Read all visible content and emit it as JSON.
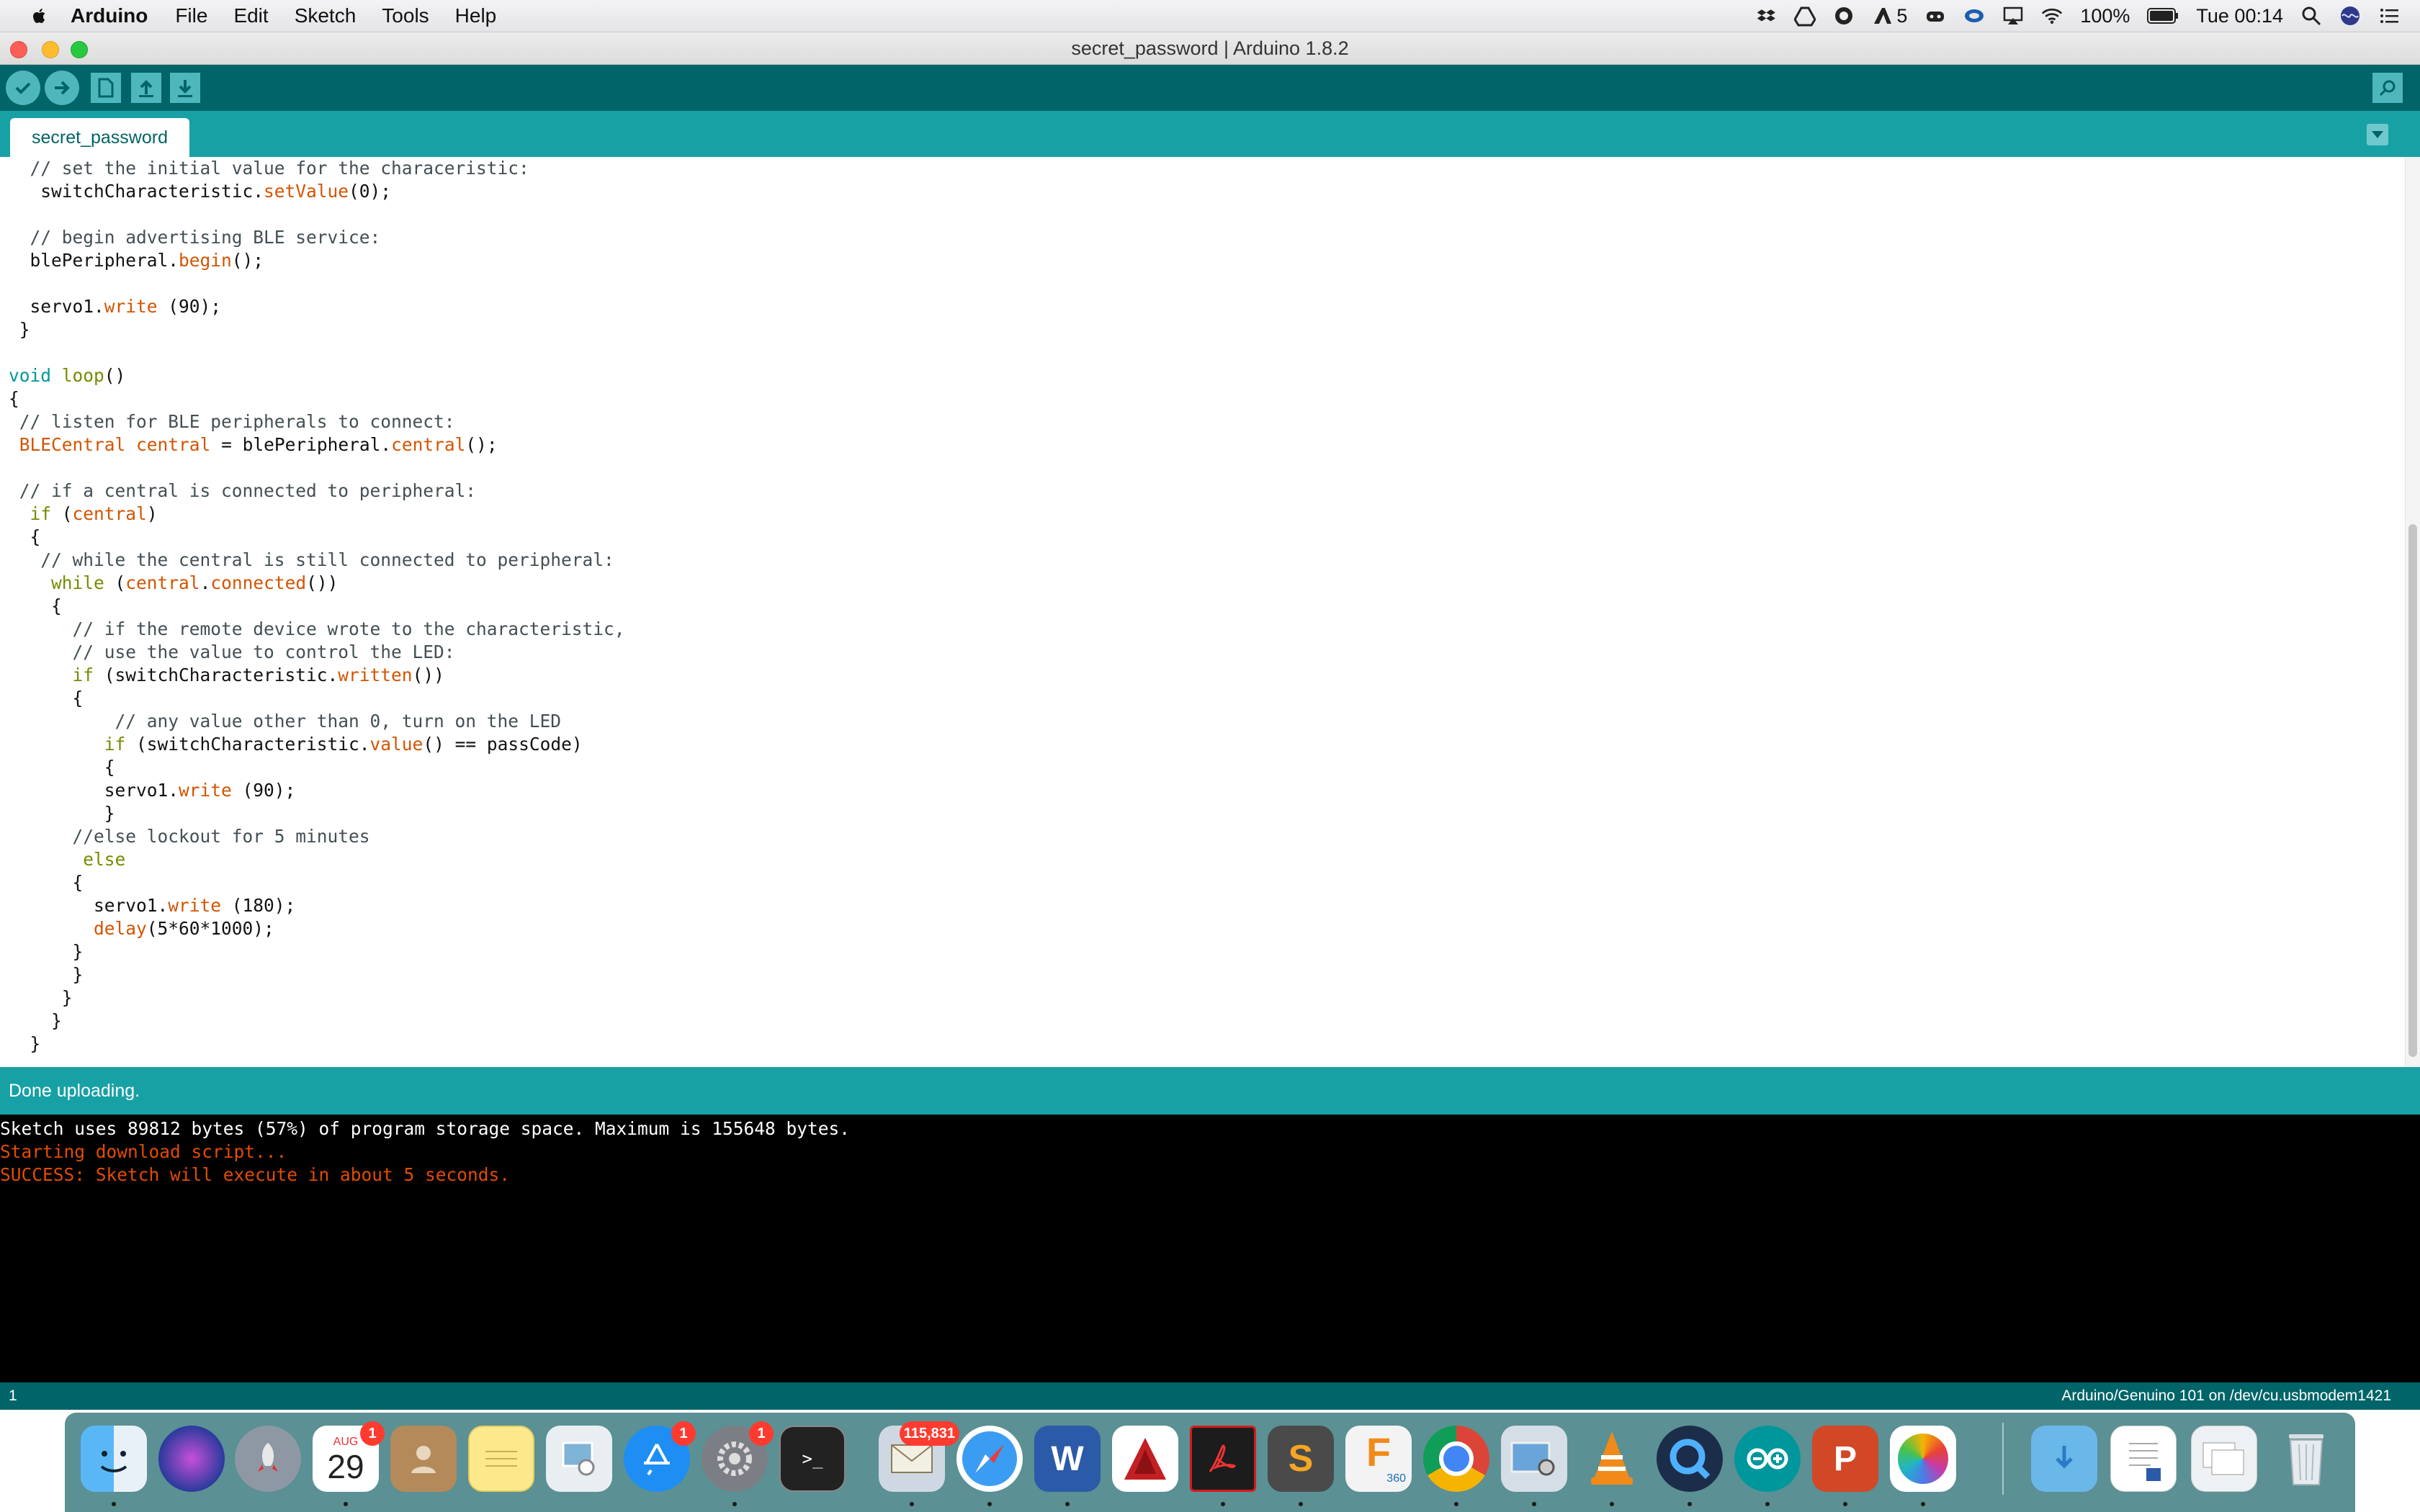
{
  "menubar": {
    "app_name": "Arduino",
    "menus": [
      "File",
      "Edit",
      "Sketch",
      "Tools",
      "Help"
    ],
    "adobe_count": "5",
    "battery": "100%",
    "clock": "Tue 00:14"
  },
  "window": {
    "title": "secret_password | Arduino 1.8.2"
  },
  "tabs": {
    "active": "secret_password"
  },
  "code_lines": [
    [
      {
        "t": "  // set the initial value for the characeristic:",
        "c": "cm"
      }
    ],
    [
      {
        "t": "   switchCharacteristic."
      },
      {
        "t": "setValue",
        "c": "fn"
      },
      {
        "t": "(0);"
      }
    ],
    [
      {
        "t": ""
      }
    ],
    [
      {
        "t": "  // begin advertising BLE service:",
        "c": "cm"
      }
    ],
    [
      {
        "t": "  blePeripheral."
      },
      {
        "t": "begin",
        "c": "fn"
      },
      {
        "t": "();"
      }
    ],
    [
      {
        "t": ""
      }
    ],
    [
      {
        "t": "  servo1."
      },
      {
        "t": "write",
        "c": "fn"
      },
      {
        "t": " (90);"
      }
    ],
    [
      {
        "t": " }"
      }
    ],
    [
      {
        "t": ""
      }
    ],
    [
      {
        "t": "void",
        "c": "ty"
      },
      {
        "t": " "
      },
      {
        "t": "loop",
        "c": "kw"
      },
      {
        "t": "()"
      }
    ],
    [
      {
        "t": "{"
      }
    ],
    [
      {
        "t": " // listen for BLE peripherals to connect:",
        "c": "cm"
      }
    ],
    [
      {
        "t": " "
      },
      {
        "t": "BLECentral",
        "c": "fn"
      },
      {
        "t": " "
      },
      {
        "t": "central",
        "c": "fn"
      },
      {
        "t": " = blePeripheral."
      },
      {
        "t": "central",
        "c": "fn"
      },
      {
        "t": "();"
      }
    ],
    [
      {
        "t": ""
      }
    ],
    [
      {
        "t": " // if a central is connected to peripheral:",
        "c": "cm"
      }
    ],
    [
      {
        "t": "  "
      },
      {
        "t": "if",
        "c": "kw"
      },
      {
        "t": " ("
      },
      {
        "t": "central",
        "c": "fn"
      },
      {
        "t": ")"
      }
    ],
    [
      {
        "t": "  {"
      }
    ],
    [
      {
        "t": "   // while the central is still connected to peripheral:",
        "c": "cm"
      }
    ],
    [
      {
        "t": "    "
      },
      {
        "t": "while",
        "c": "kw"
      },
      {
        "t": " ("
      },
      {
        "t": "central",
        "c": "fn"
      },
      {
        "t": "."
      },
      {
        "t": "connected",
        "c": "fn"
      },
      {
        "t": "())"
      }
    ],
    [
      {
        "t": "    {"
      }
    ],
    [
      {
        "t": "      // if the remote device wrote to the characteristic,",
        "c": "cm"
      }
    ],
    [
      {
        "t": "      // use the value to control the LED:",
        "c": "cm"
      }
    ],
    [
      {
        "t": "      "
      },
      {
        "t": "if",
        "c": "kw"
      },
      {
        "t": " (switchCharacteristic."
      },
      {
        "t": "written",
        "c": "fn"
      },
      {
        "t": "())"
      }
    ],
    [
      {
        "t": "      {"
      }
    ],
    [
      {
        "t": "          // any value other than 0, turn on the LED",
        "c": "cm"
      }
    ],
    [
      {
        "t": "         "
      },
      {
        "t": "if",
        "c": "kw"
      },
      {
        "t": " (switchCharacteristic."
      },
      {
        "t": "value",
        "c": "fn"
      },
      {
        "t": "() == passCode)"
      }
    ],
    [
      {
        "t": "         {"
      }
    ],
    [
      {
        "t": "         servo1."
      },
      {
        "t": "write",
        "c": "fn"
      },
      {
        "t": " (90);"
      }
    ],
    [
      {
        "t": "         }"
      }
    ],
    [
      {
        "t": "      //else lockout for 5 minutes",
        "c": "cm"
      }
    ],
    [
      {
        "t": "       "
      },
      {
        "t": "else",
        "c": "kw"
      }
    ],
    [
      {
        "t": "      {"
      }
    ],
    [
      {
        "t": "        servo1."
      },
      {
        "t": "write",
        "c": "fn"
      },
      {
        "t": " (180);"
      }
    ],
    [
      {
        "t": "        "
      },
      {
        "t": "delay",
        "c": "fn"
      },
      {
        "t": "(5*60*1000);"
      }
    ],
    [
      {
        "t": "      }"
      }
    ],
    [
      {
        "t": "      }"
      }
    ],
    [
      {
        "t": "     }"
      }
    ],
    [
      {
        "t": "    }"
      }
    ],
    [
      {
        "t": "  }"
      }
    ]
  ],
  "status": {
    "message": "Done uploading."
  },
  "console_lines": [
    {
      "text": "Sketch uses 89812 bytes (57%) of program storage space. Maximum is 155648 bytes.",
      "kind": "out"
    },
    {
      "text": "Starting download script...",
      "kind": "err"
    },
    {
      "text": "SUCCESS: Sketch will execute in about 5 seconds.",
      "kind": "err"
    }
  ],
  "footer": {
    "line": "1",
    "board": "Arduino/Genuino 101 on /dev/cu.usbmodem1421"
  },
  "dock": {
    "calendar_month": "AUG",
    "calendar_day": "29",
    "calendar_badge": "1",
    "appstore_badge": "1",
    "prefs_badge": "1",
    "mail_badge": "115,831",
    "fusion_label": "360"
  },
  "colors": {
    "toolbar": "#006468",
    "tabbar": "#17a1a5",
    "comment": "#434f54",
    "keyword": "#728e00",
    "function": "#d35400",
    "console_error": "#e34c00"
  }
}
